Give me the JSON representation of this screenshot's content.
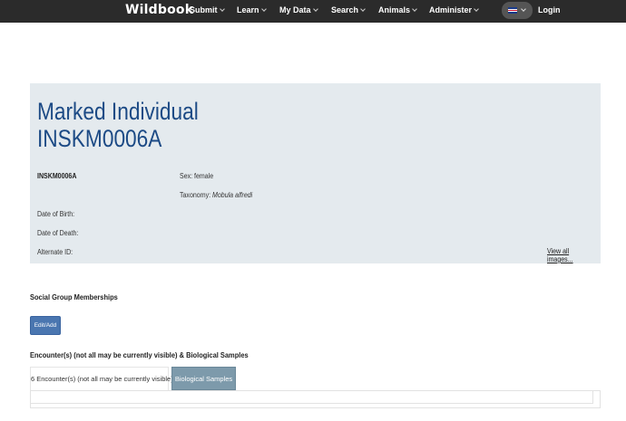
{
  "nav": {
    "brand": "Wildbook",
    "menus": [
      "Submit",
      "Learn",
      "My Data",
      "Search",
      "Animals",
      "Administer"
    ],
    "language": "english-flag-icon",
    "login": "Login"
  },
  "individual": {
    "title_line1": "Marked Individual",
    "title_line2": "INSKM0006A",
    "id": "INSKM0006A",
    "sex": "Sex: female",
    "taxonomy_label": "Taxonomy: ",
    "taxonomy_value": "Mobula alfredi",
    "date_of_birth": "Date of Birth:",
    "date_of_death": "Date of Death:",
    "alternate_id": "Alternate ID:",
    "view_images": "View all images..."
  },
  "social": {
    "title": "Social Group Memberships",
    "edit_button": "Edit/Add"
  },
  "encounters": {
    "title": "Encounter(s) (not all may be currently visible) & Biological Samples",
    "tabs": [
      "6 Encounter(s) (not all may be currently visible)",
      "Biological Samples"
    ]
  },
  "colors": {
    "navbar": "#2b2b2b",
    "panel": "#e4eaee",
    "title": "#1c4a85",
    "button": "#4a76b0",
    "inactive_tab": "#7d9aab"
  }
}
